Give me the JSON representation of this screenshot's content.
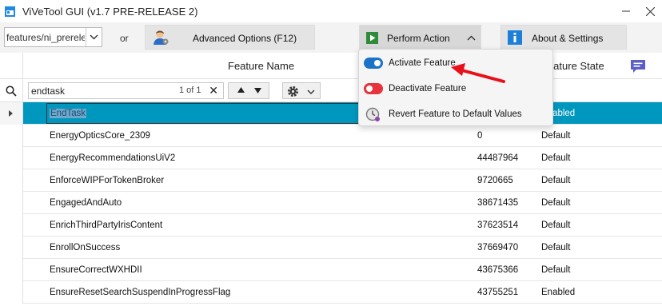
{
  "window": {
    "title": "ViVeTool GUI (v1.7 PRE-RELEASE 2)",
    "minimize_icon": "minimize-icon",
    "close_icon": "close-icon"
  },
  "toolbar": {
    "branch_value": "features/ni_prerelease",
    "or_label": "or",
    "advanced_options_label": "Advanced Options (F12)",
    "perform_action_label": "Perform Action",
    "about_settings_label": "About & Settings"
  },
  "grid": {
    "header_name": "Feature Name",
    "header_state": "Feature State",
    "search_value": "endtask",
    "search_count": "1 of 1",
    "rows": [
      {
        "name": "EndTask",
        "id": "",
        "state": "Enabled"
      },
      {
        "name": "EnergyOpticsCore_2309",
        "id": "0",
        "state": "Default"
      },
      {
        "name": "EnergyRecommendationsUiV2",
        "id": "44487964",
        "state": "Default"
      },
      {
        "name": "EnforceWIPForTokenBroker",
        "id": "9720665",
        "state": "Default"
      },
      {
        "name": "EngagedAndAuto",
        "id": "38671435",
        "state": "Default"
      },
      {
        "name": "EnrichThirdPartyIrisContent",
        "id": "37623514",
        "state": "Default"
      },
      {
        "name": "EnrollOnSuccess",
        "id": "37669470",
        "state": "Default"
      },
      {
        "name": "EnsureCorrectWXHDII",
        "id": "43675366",
        "state": "Default"
      },
      {
        "name": "EnsureResetSearchSuspendInProgressFlag",
        "id": "43755251",
        "state": "Enabled"
      }
    ]
  },
  "menu": {
    "items": [
      {
        "label": "Activate Feature",
        "icon": "toggle-on-icon",
        "color": "#1a73c9"
      },
      {
        "label": "Deactivate Feature",
        "icon": "toggle-off-icon",
        "color": "#e8323c"
      },
      {
        "label": "Revert Feature to Default Values",
        "icon": "clock-revert-icon",
        "color": "#888888"
      }
    ]
  },
  "colors": {
    "selected_row": "#0097bf",
    "annotation_arrow": "#e8101a"
  }
}
